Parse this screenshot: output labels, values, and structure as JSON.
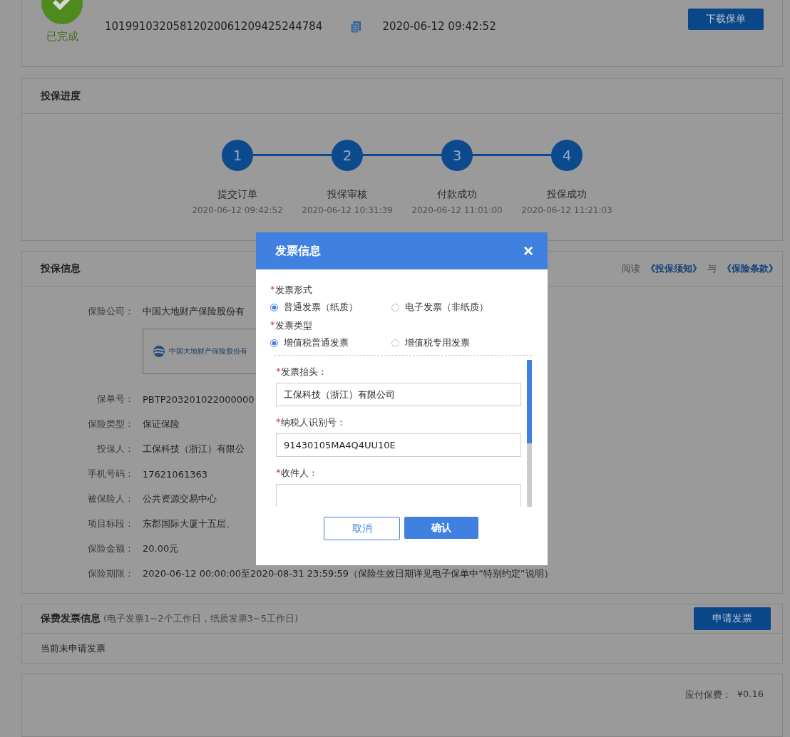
{
  "order": {
    "status": "已完成",
    "number": "10199103205812020061209425244784",
    "time": "2020-06-12 09:42:52",
    "download_button": "下载保单"
  },
  "progress": {
    "title": "投保进度",
    "steps": [
      {
        "number": "1",
        "label": "提交订单",
        "time": "2020-06-12 09:42:52"
      },
      {
        "number": "2",
        "label": "投保审核",
        "time": "2020-06-12 10:31:39"
      },
      {
        "number": "3",
        "label": "付款成功",
        "time": "2020-06-12 11:01:00"
      },
      {
        "number": "4",
        "label": "投保成功",
        "time": "2020-06-12 11:21:03"
      }
    ]
  },
  "info": {
    "title": "投保信息",
    "read_prefix": "阅读",
    "link_1": "《投保须知》",
    "joiner": "与",
    "link_2": "《保险条款》",
    "rows": [
      {
        "kind": "text",
        "label": "保险公司：",
        "value": "中国大地财产保险股份有"
      },
      {
        "kind": "logo",
        "value": "中国大地财产保险股份有"
      },
      {
        "kind": "text",
        "label": "保单号：",
        "value": "PBTP203201022000000"
      },
      {
        "kind": "text",
        "label": "保险类型：",
        "value": "保证保险"
      },
      {
        "kind": "text",
        "label": "投保人：",
        "value": "工保科技（浙江）有限公"
      },
      {
        "kind": "text",
        "label": "手机号码：",
        "value": "17621061363"
      },
      {
        "kind": "text",
        "label": "被保险人：",
        "value": "公共资源交易中心"
      },
      {
        "kind": "text",
        "label": "项目标段：",
        "value": "东郡国际大厦十五层、"
      },
      {
        "kind": "text",
        "label": "保险金额：",
        "value": "20.00元"
      },
      {
        "kind": "text",
        "label": "保险期限：",
        "value": "2020-06-12 00:00:00至2020-08-31 23:59:59（保险生效日期详见电子保单中“特别约定”说明）"
      }
    ]
  },
  "invoice": {
    "title": "保费发票信息",
    "note": "(电子发票1~2个工作日，纸质发票3~5工作日)",
    "apply_button": "申请发票",
    "status": "当前未申请发票"
  },
  "payment": {
    "label": "应付保费：",
    "amount": "¥0.16"
  },
  "dialog": {
    "title": "发票信息",
    "close": "×",
    "groups": [
      {
        "mark": "*",
        "label": "发票形式",
        "options": [
          {
            "label": "普通发票（纸质）",
            "selected": true
          },
          {
            "label": "电子发票（非纸质）",
            "selected": false
          }
        ]
      },
      {
        "mark": "*",
        "label": "发票类型",
        "options": [
          {
            "label": "增值税普通发票",
            "selected": true
          },
          {
            "label": "增值税专用发票",
            "selected": false
          }
        ]
      }
    ],
    "fields": [
      {
        "mark": "*",
        "label": "发票抬头：",
        "value": "工保科技（浙江）有限公司"
      },
      {
        "mark": "*",
        "label": "纳税人识别号：",
        "value": "91430105MA4Q4UU10E"
      },
      {
        "mark": "*",
        "label": "收件人："
      }
    ],
    "cancel_button": "取消",
    "confirm_button": "确认"
  }
}
